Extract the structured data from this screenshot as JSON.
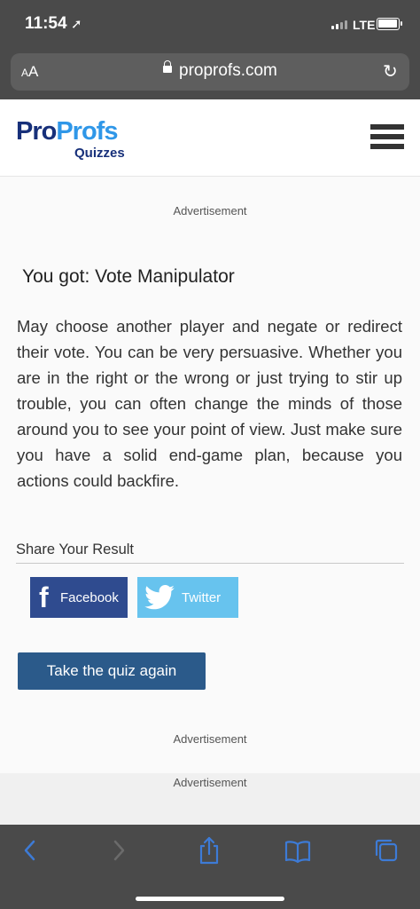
{
  "status_bar": {
    "time": "11:54",
    "network": "LTE"
  },
  "browser": {
    "text_size_label": "AA",
    "domain": "proprofs.com"
  },
  "site": {
    "logo_pro": "Pro",
    "logo_profs": "Profs",
    "logo_sub": "Quizzes"
  },
  "ads": {
    "label": "Advertisement"
  },
  "result": {
    "title": "You got: Vote Manipulator",
    "description": "May choose another player and negate or redirect their vote. You can be very persuasive. Whether you are in the right or the wrong or just trying to stir up trouble, you can often change the minds of those around you to see your point of view. Just make sure you have a solid end-game plan, because you actions could backfire."
  },
  "share": {
    "title": "Share Your Result",
    "facebook": "Facebook",
    "twitter": "Twitter"
  },
  "actions": {
    "retake": "Take the quiz again"
  },
  "colors": {
    "brand_dark": "#17307a",
    "brand_light": "#2f97e8",
    "facebook": "#2f4b8f",
    "twitter": "#67c3ee",
    "button": "#2b5a8a",
    "toolbar_icons": "#3d7bd6"
  },
  "icons": [
    "location-arrow-icon",
    "lock-icon",
    "reload-icon",
    "hamburger-menu-icon",
    "facebook-icon",
    "twitter-bird-icon",
    "back-icon",
    "forward-icon",
    "share-icon",
    "bookmarks-icon",
    "tabs-icon"
  ]
}
